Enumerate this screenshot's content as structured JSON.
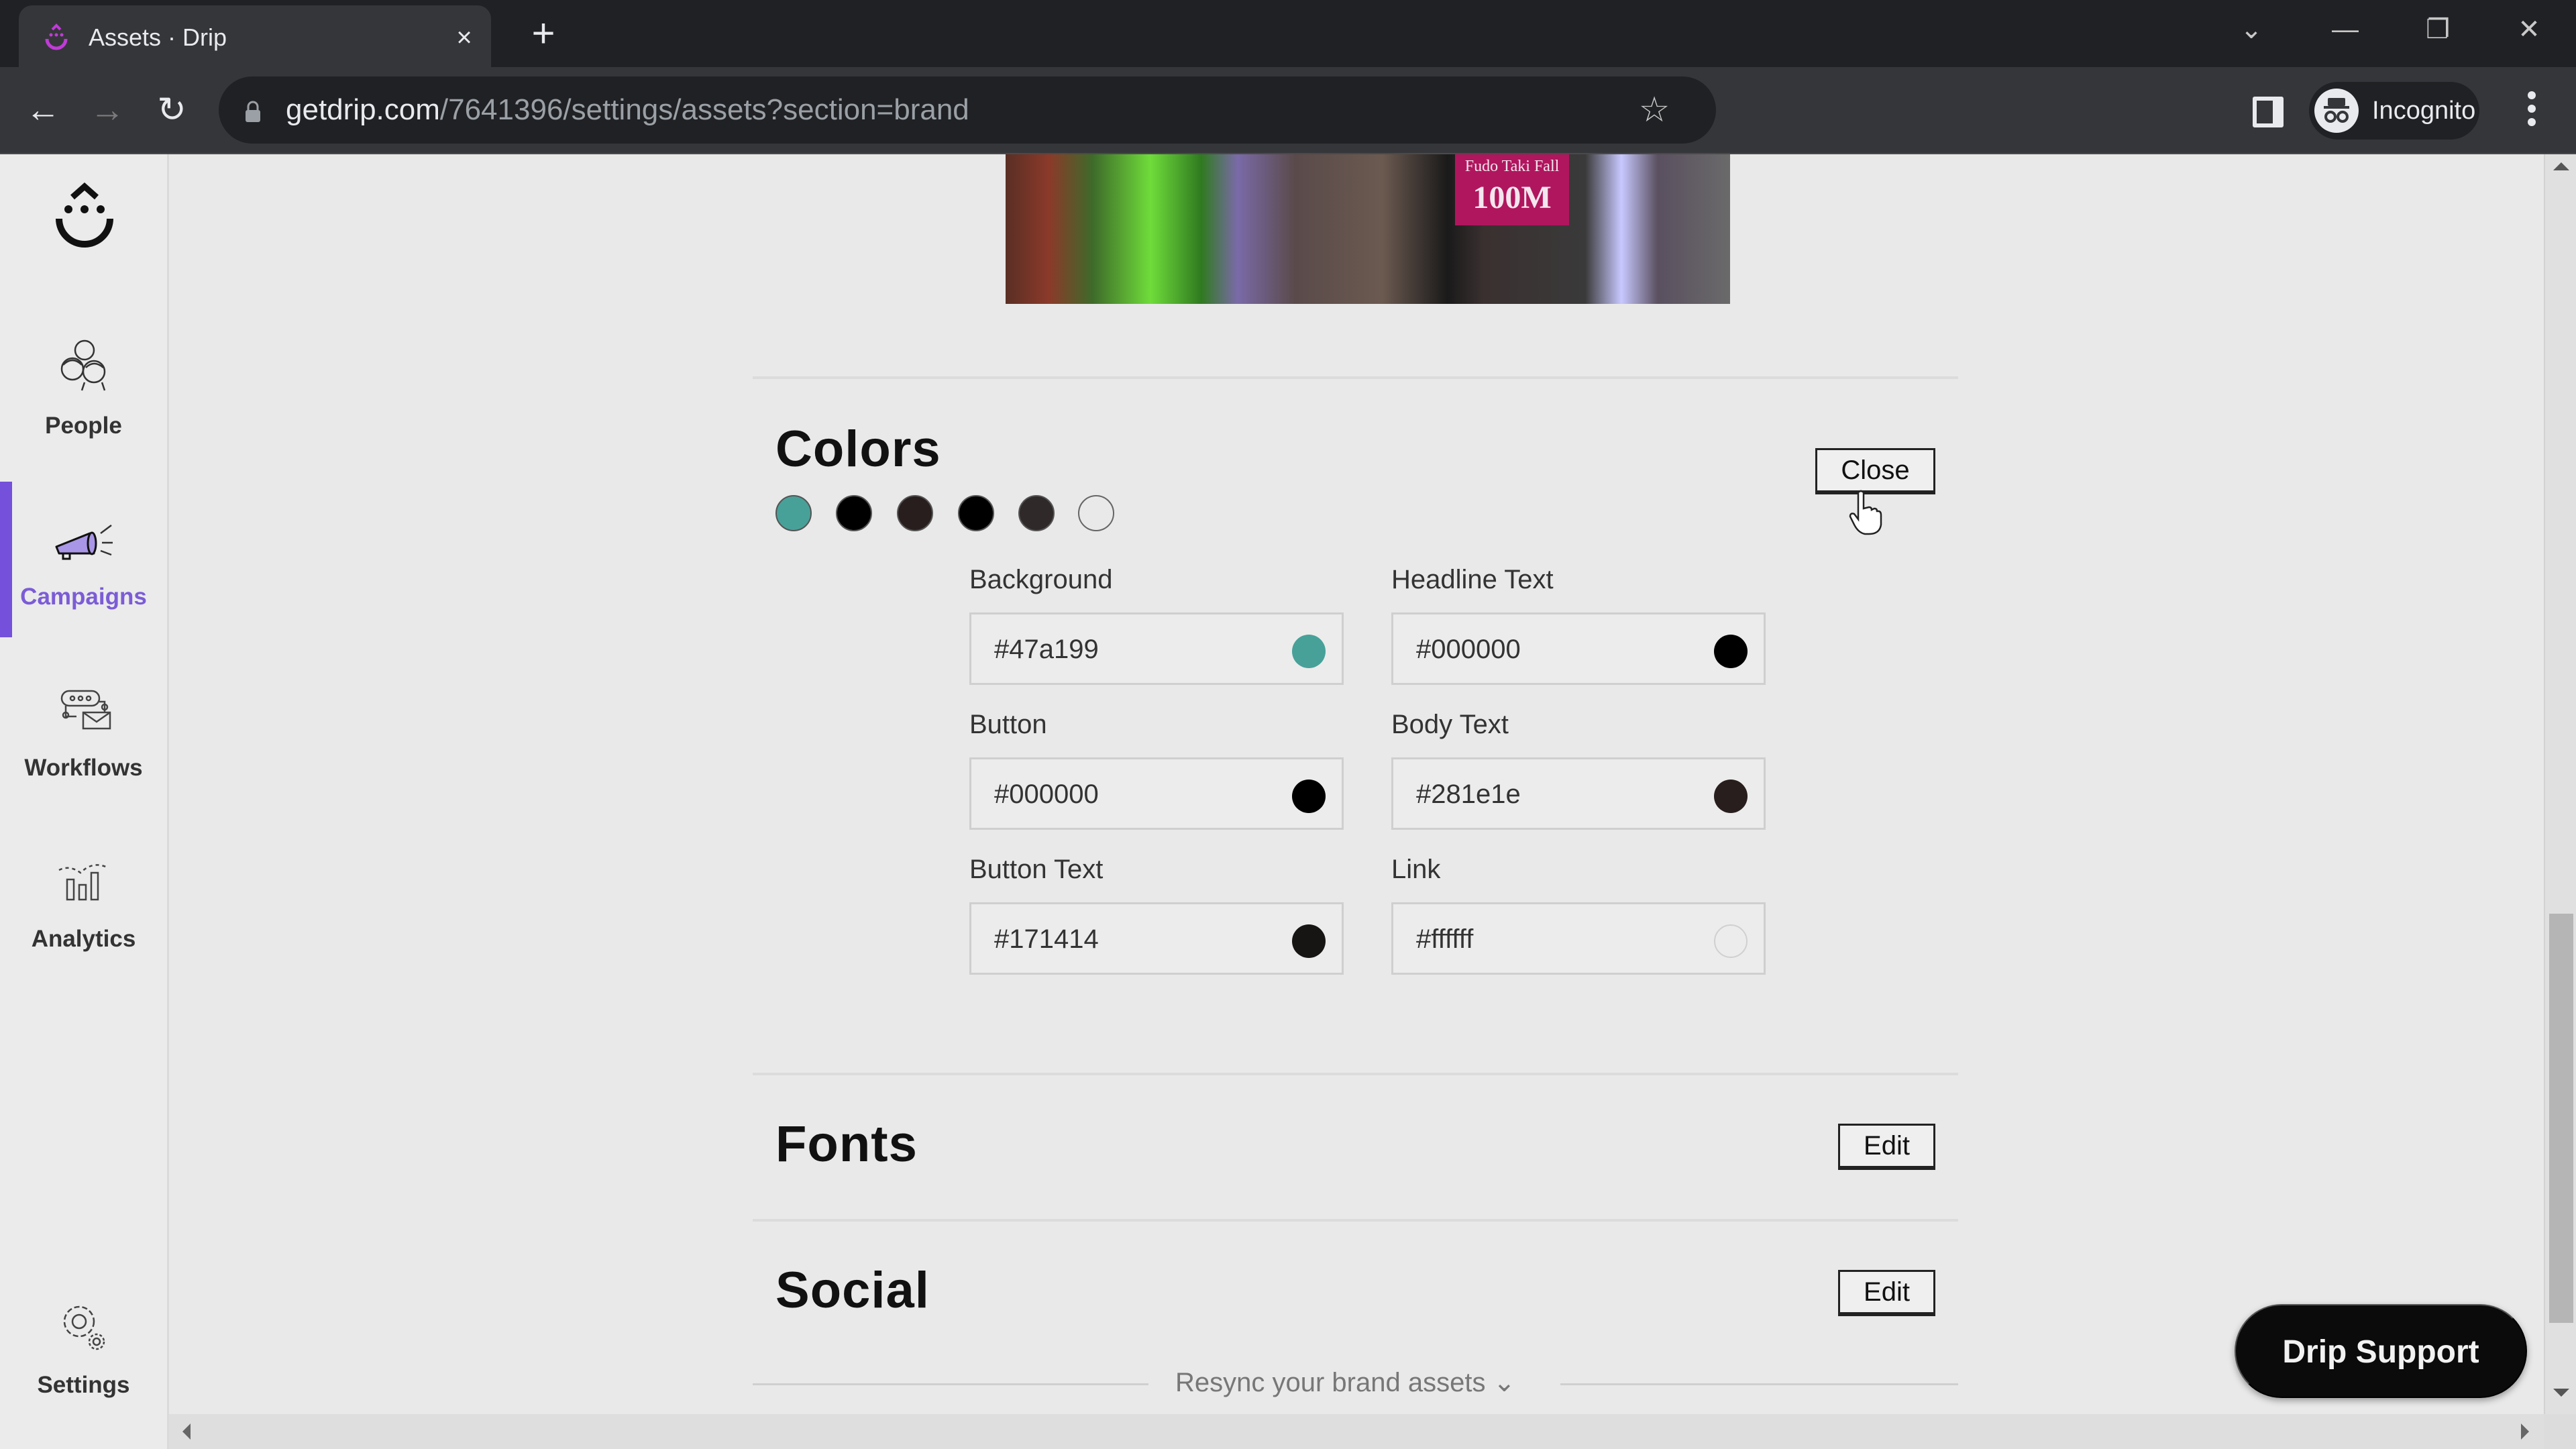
{
  "browser": {
    "tab_title": "Assets · Drip",
    "tab_close": "×",
    "new_tab": "+",
    "url_host": "getdrip.com",
    "url_path": "/7641396/settings/assets?section=brand",
    "profile_label": "Incognito",
    "window_controls": {
      "tab_search": "⌄",
      "minimize": "—",
      "restore": "❐",
      "close": "✕"
    },
    "nav": {
      "back": "←",
      "forward": "→",
      "reload": "↻"
    },
    "bookmark_star": "☆"
  },
  "sidebar": {
    "items": [
      {
        "label": "People",
        "icon": "people-icon",
        "active": false
      },
      {
        "label": "Campaigns",
        "icon": "megaphone-icon",
        "active": true
      },
      {
        "label": "Workflows",
        "icon": "workflow-icon",
        "active": false
      },
      {
        "label": "Analytics",
        "icon": "analytics-icon",
        "active": false
      },
      {
        "label": "Settings",
        "icon": "gear-icon",
        "active": false
      }
    ],
    "accent_color": "#7450db"
  },
  "hero_image": {
    "sign_line1": "Fudo Taki Fall",
    "sign_line2": "100M"
  },
  "colors_section": {
    "title": "Colors",
    "close_label": "Close",
    "swatches": [
      "#47a199",
      "#000000",
      "#281e1e",
      "#000000",
      "#2f2929",
      "#ffffff"
    ],
    "fields": [
      {
        "label": "Background",
        "value": "#47a199",
        "color": "#47a199"
      },
      {
        "label": "Headline Text",
        "value": "#000000",
        "color": "#000000"
      },
      {
        "label": "Button",
        "value": "#000000",
        "color": "#000000"
      },
      {
        "label": "Body Text",
        "value": "#281e1e",
        "color": "#281e1e"
      },
      {
        "label": "Button Text",
        "value": "#171414",
        "color": "#171414"
      },
      {
        "label": "Link",
        "value": "#ffffff",
        "color": "#ffffff"
      }
    ]
  },
  "fonts_section": {
    "title": "Fonts",
    "edit_label": "Edit"
  },
  "social_section": {
    "title": "Social",
    "edit_label": "Edit"
  },
  "resync": {
    "label": "Resync your brand assets",
    "chevron": "⌄"
  },
  "support_button": {
    "label": "Drip Support"
  }
}
